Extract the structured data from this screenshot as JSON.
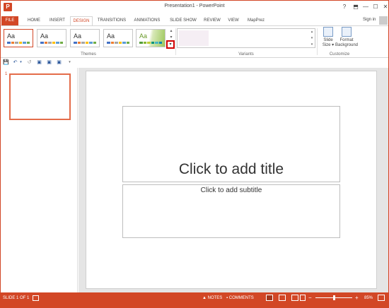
{
  "window": {
    "title": "Presentation1 - PowerPoint",
    "app_icon_letter": "P",
    "help": "?",
    "ribbon_display": "⬒",
    "minimize": "—",
    "maximize": "☐",
    "close": "✕"
  },
  "tabs": [
    {
      "label": "FILE"
    },
    {
      "label": "HOME"
    },
    {
      "label": "INSERT"
    },
    {
      "label": "DESIGN"
    },
    {
      "label": "TRANSITIONS"
    },
    {
      "label": "ANIMATIONS"
    },
    {
      "label": "SLIDE SHOW"
    },
    {
      "label": "REVIEW"
    },
    {
      "label": "VIEW"
    },
    {
      "label": "MapPrez"
    }
  ],
  "active_tab": "DESIGN",
  "account": {
    "signin": "Sign in"
  },
  "ribbon": {
    "themes": {
      "label": "Themes",
      "items": [
        {
          "text": "Aa",
          "colors": [
            "#4472c4",
            "#ed7d31",
            "#a5a5a5",
            "#ffc000",
            "#5b9bd5",
            "#70ad47"
          ]
        },
        {
          "text": "Aa",
          "colors": [
            "#4472c4",
            "#ed7d31",
            "#a5a5a5",
            "#ffc000",
            "#5b9bd5",
            "#70ad47"
          ]
        },
        {
          "text": "Aa",
          "colors": [
            "#4472c4",
            "#ed7d31",
            "#a5a5a5",
            "#ffc000",
            "#5b9bd5",
            "#70ad47"
          ]
        },
        {
          "text": "Aa",
          "colors": [
            "#4472c4",
            "#ed7d31",
            "#a5a5a5",
            "#ffc000",
            "#5b9bd5",
            "#70ad47"
          ]
        },
        {
          "text": "Aa",
          "colors": [
            "#549e39",
            "#8ab833",
            "#c0cf3a",
            "#029676",
            "#4ab5c4",
            "#0989b1"
          ]
        }
      ],
      "scroll_up": "▴",
      "scroll_down": "▾",
      "more": "▾"
    },
    "variants": {
      "label": "Variants",
      "scroll_up": "▴",
      "scroll_down": "▾",
      "more": "▾"
    },
    "customize": {
      "label": "Customize",
      "slide_size_line1": "Slide",
      "slide_size_line2": "Size ▾",
      "format_bg_line1": "Format",
      "format_bg_line2": "Background"
    }
  },
  "qat": {
    "save": "💾",
    "undo": "↶",
    "undo_arrow": "▾",
    "redo": "↺",
    "icon4": "▣",
    "icon5": "▣",
    "icon6": "▣",
    "customize": "▾"
  },
  "thumbnails": [
    {
      "number": "1"
    }
  ],
  "slide": {
    "title_placeholder": "Click to add title",
    "subtitle_placeholder": "Click to add subtitle"
  },
  "statusbar": {
    "slide_info": "SLIDE 1 OF 1",
    "notes": "NOTES",
    "comments": "COMMENTS",
    "zoom_minus": "−",
    "zoom_plus": "+",
    "zoom_level": "85%",
    "zoom_fraction": 0.5
  },
  "colors": {
    "accent": "#d24726",
    "highlight_box": "#d00000"
  }
}
